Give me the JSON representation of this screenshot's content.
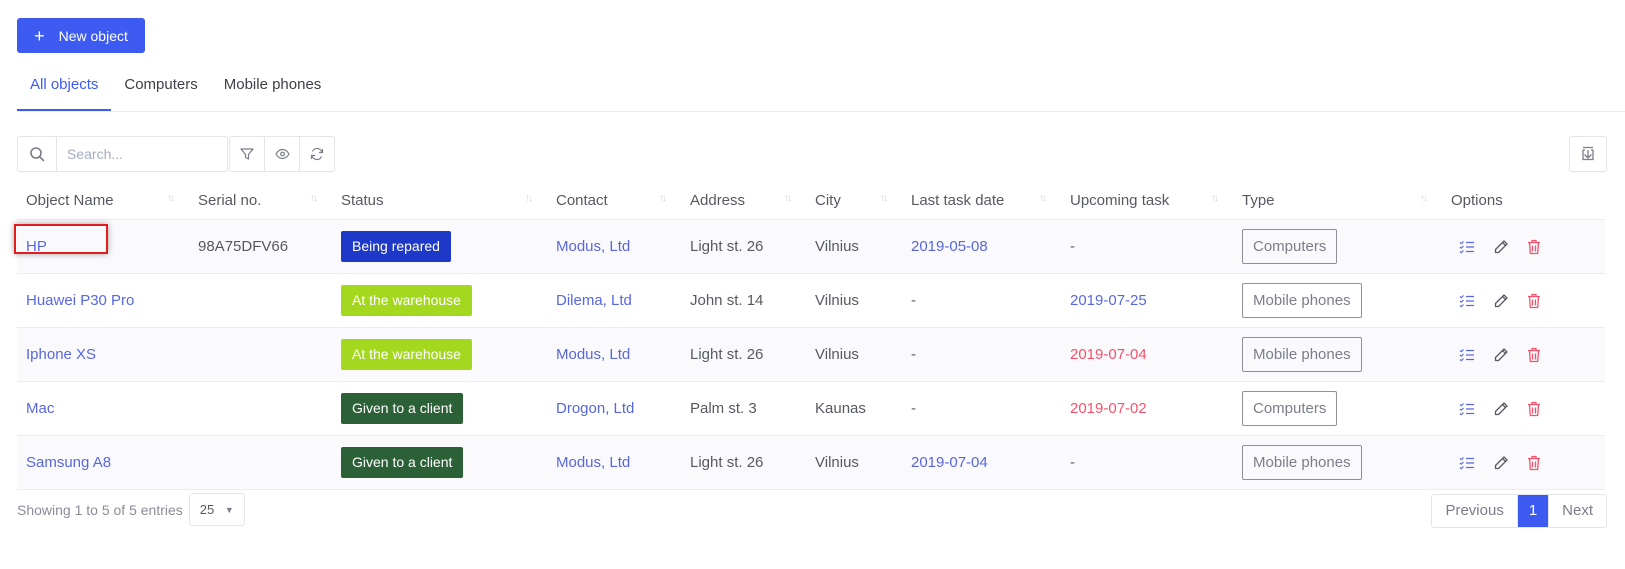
{
  "toolbar": {
    "new_label": "New object"
  },
  "tabs": [
    {
      "label": "All objects",
      "active": true
    },
    {
      "label": "Computers",
      "active": false
    },
    {
      "label": "Mobile phones",
      "active": false
    }
  ],
  "search": {
    "placeholder": "Search..."
  },
  "columns": [
    "Object Name",
    "Serial no.",
    "Status",
    "Contact",
    "Address",
    "City",
    "Last task date",
    "Upcoming task",
    "Type",
    "Options"
  ],
  "rows": [
    {
      "name": "HP",
      "serial": "98A75DFV66",
      "status": "Being repared",
      "status_color": "#1e38c7",
      "contact": "Modus, Ltd",
      "address": "Light st. 26",
      "city": "Vilnius",
      "last_task": "2019-05-08",
      "upcoming": "-",
      "type": "Computers"
    },
    {
      "name": "Huawei P30 Pro",
      "serial": "",
      "status": "At the warehouse",
      "status_color": "#a4d81f",
      "contact": "Dilema, Ltd",
      "address": "John st. 14",
      "city": "Vilnius",
      "last_task": "-",
      "upcoming": "2019-07-25",
      "type": "Mobile phones"
    },
    {
      "name": "Iphone XS",
      "serial": "",
      "status": "At the warehouse",
      "status_color": "#a4d81f",
      "contact": "Modus, Ltd",
      "address": "Light st. 26",
      "city": "Vilnius",
      "last_task": "-",
      "upcoming": "2019-07-04",
      "type": "Mobile phones"
    },
    {
      "name": "Mac",
      "serial": "",
      "status": "Given to a client",
      "status_color": "#2c6137",
      "contact": "Drogon, Ltd",
      "address": "Palm st. 3",
      "city": "Kaunas",
      "last_task": "-",
      "upcoming": "2019-07-02",
      "type": "Computers"
    },
    {
      "name": "Samsung A8",
      "serial": "",
      "status": "Given to a client",
      "status_color": "#2c6137",
      "contact": "Modus, Ltd",
      "address": "Light st. 26",
      "city": "Vilnius",
      "last_task": "2019-07-04",
      "upcoming": "-",
      "type": "Mobile phones"
    }
  ],
  "footer": {
    "info": "Showing 1 to 5 of 5 entries",
    "page_size": "25",
    "prev": "Previous",
    "current_page": "1",
    "next": "Next"
  },
  "colors": {
    "primary": "#3d5af1",
    "link": "#5867dd",
    "danger": "#f4516c",
    "highlight": "#e01e1e"
  },
  "icons": {
    "search": "search-icon",
    "filter": "filter-icon",
    "eye": "eye-icon",
    "refresh": "refresh-icon",
    "export": "export-icon",
    "tasks": "checklist-icon",
    "edit": "pencil-icon",
    "delete": "trash-icon"
  }
}
